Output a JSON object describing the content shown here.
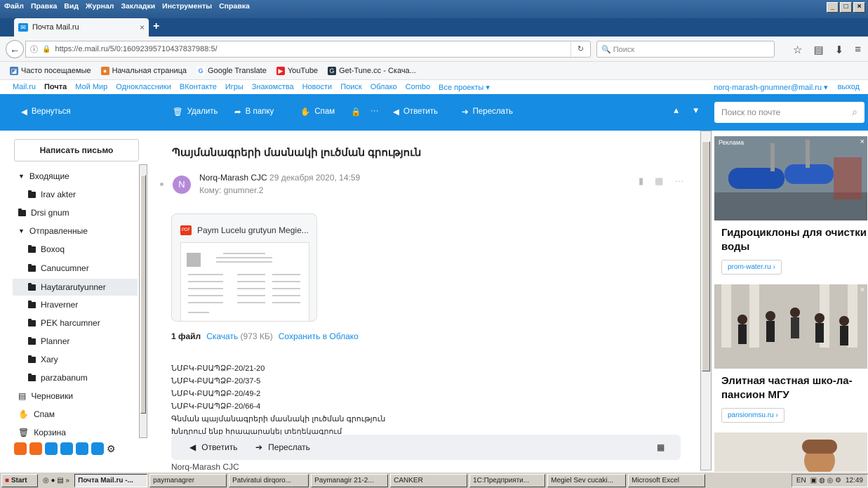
{
  "browser": {
    "menu": [
      "Файл",
      "Правка",
      "Вид",
      "Журнал",
      "Закладки",
      "Инструменты",
      "Справка"
    ],
    "tab_title": "Почта Mail.ru",
    "url": "https://e.mail.ru/5/0:16092395710437837988:5/",
    "search_placeholder": "Поиск",
    "bookmarks": [
      "Часто посещаемые",
      "Начальная страница",
      "Google Translate",
      "YouTube",
      "Get-Tune.cc - Скача..."
    ]
  },
  "portal": {
    "links": [
      "Mail.ru",
      "Почта",
      "Мой Мир",
      "Одноклассники",
      "ВКонтакте",
      "Игры",
      "Знакомства",
      "Новости",
      "Поиск",
      "Облако",
      "Combo",
      "Все проекты ▾"
    ],
    "user": "norq-marash-gnumner@mail.ru ▾",
    "logout": "выход"
  },
  "toolbar": {
    "back": "Вернуться",
    "delete": "Удалить",
    "to_folder": "В папку",
    "spam": "Спам",
    "more": "···",
    "reply": "Ответить",
    "forward": "Переслать",
    "search_placeholder": "Поиск по почте"
  },
  "sidebar": {
    "compose": "Написать письмо",
    "folders": [
      "Входящие",
      "Irav akter",
      "Drsi gnum",
      "Отправленные",
      "Boxoq",
      "Canucumner",
      "Haytararutyunner",
      "Hraverner",
      "PEK harcumner",
      "Planner",
      "Xary",
      "parzabanum",
      "Черновики",
      "Спам",
      "Корзина"
    ]
  },
  "message": {
    "subject": "Պայմանագրերի մասնակի լուծման գրություն",
    "avatar_letter": "N",
    "from": "Norq-Marash CJC",
    "date": "29 декабря 2020, 14:59",
    "to": "Кому: gnumner.2",
    "attachment_name": "Paym Lucelu grutyun Megie...",
    "files_count": "1 файл",
    "download": "Скачать",
    "size": "(973 КБ)",
    "save_cloud": "Сохранить в Облако",
    "body_lines": [
      "ՆՄԲԿ-ԲՍԱՊՁԲ-20/21-20",
      "ՆՄԲԿ-ԲՍԱՊՁԲ-20/37-5",
      "ՆՄԲԿ-ԲՍԱՊՁԲ-20/49-2",
      "ՆՄԲԿ-ԲՍԱՊՁԲ-20/66-4",
      "Գնման պայմանագրերի մասնակի լուծման գրություն",
      "Խնդրում ենք հրապարակել տեղեկագրում"
    ],
    "signature": "Norq-Marash CJC",
    "reply": "Ответить",
    "forward": "Переслать"
  },
  "ads": {
    "label": "Реклама",
    "ad1_title": "Гидроциклоны для очистки воды",
    "ad1_link": "prom-water.ru ›",
    "ad2_title": "Элитная частная шко-ла-пансион МГУ",
    "ad2_link": "pansionmsu.ru ›"
  },
  "taskbar": {
    "start": "Start",
    "tasks": [
      "Почта Mail.ru -...",
      "paymanagrer",
      "Patviratui dirqoro...",
      "Paymanagir 21-2...",
      "CANKER",
      "1С:Предприяти...",
      "Megiel Sev cucaki...",
      "Microsoft Excel"
    ],
    "lang": "EN",
    "time": "12:49"
  }
}
